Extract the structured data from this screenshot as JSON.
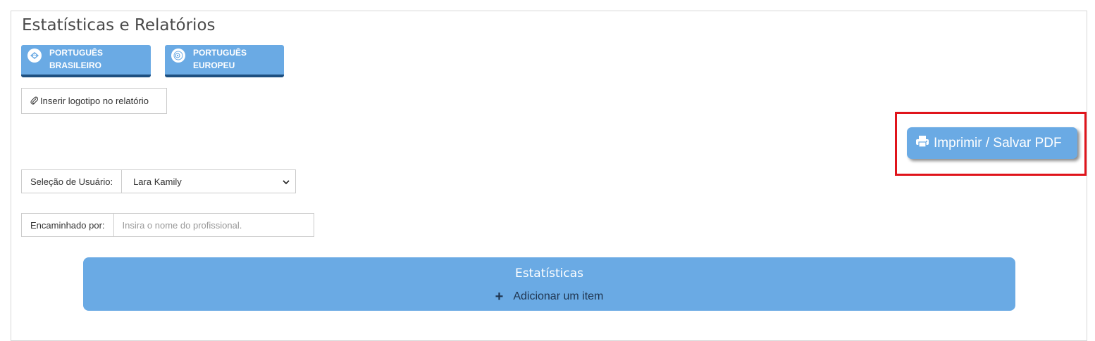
{
  "page": {
    "title": "Estatísticas e Relatórios"
  },
  "languages": [
    {
      "line1": "PORTUGUÊS",
      "line2": "BRASILEIRO",
      "icon": "brazil-flag-icon"
    },
    {
      "line1": "PORTUGUÊS",
      "line2": "EUROPEU",
      "icon": "portugal-flag-icon"
    }
  ],
  "toolbar": {
    "logo_label": "Inserir logotipo no relatório",
    "logo_icon": "paperclip-icon",
    "print_label": "Imprimir / Salvar PDF",
    "print_icon": "printer-icon"
  },
  "user_select": {
    "label": "Seleção de Usuário:",
    "value": "Lara Kamily"
  },
  "referred_by": {
    "label": "Encaminhado por:",
    "placeholder": "Insira o nome do profissional.",
    "value": ""
  },
  "stats": {
    "title": "Estatísticas",
    "add_label": "Adicionar um item"
  },
  "colors": {
    "accent": "#6aaae4",
    "accent_dark": "#1d4f80",
    "highlight": "#e0141b"
  }
}
